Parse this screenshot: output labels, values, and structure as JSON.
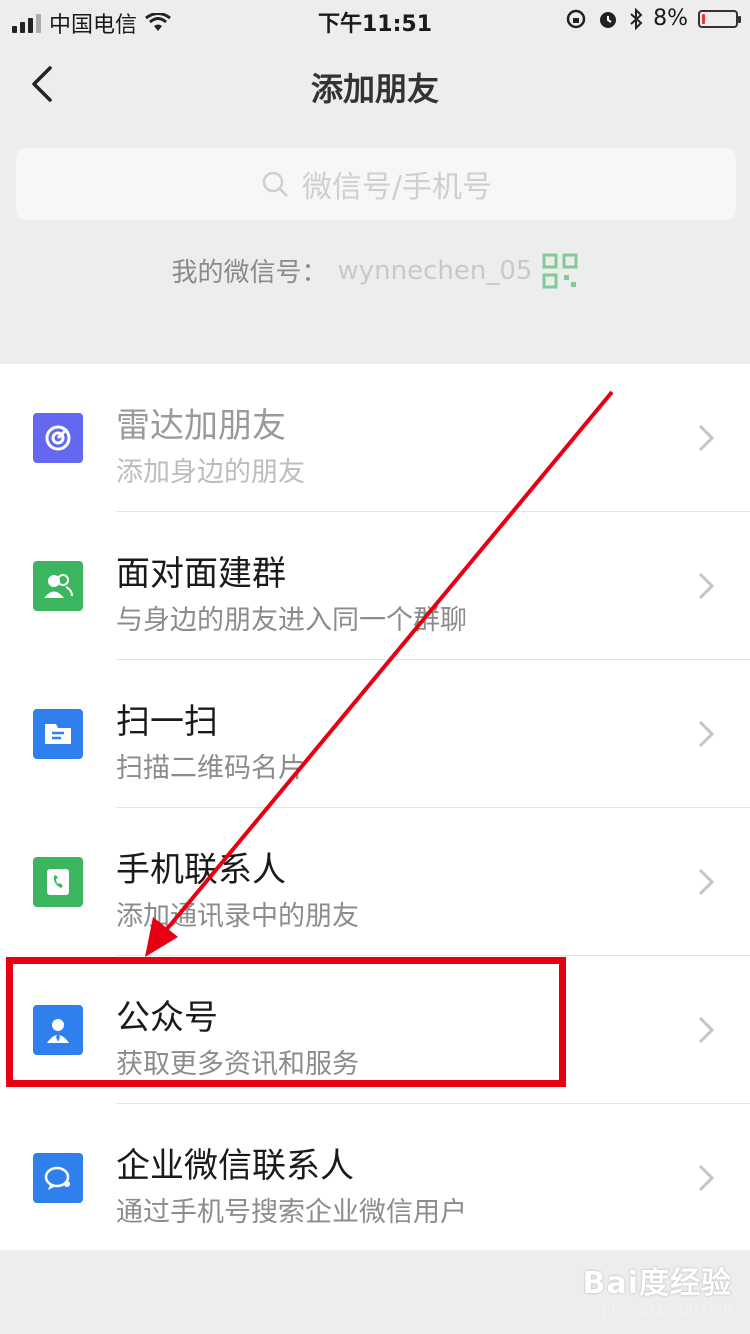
{
  "status_bar": {
    "carrier": "中国电信",
    "time": "下午11:51",
    "battery_percent": "8%",
    "battery_level": 0.08,
    "icons": [
      "signal-icon",
      "wifi-icon",
      "rotation-lock-icon",
      "alarm-icon",
      "bluetooth-icon",
      "battery-icon"
    ]
  },
  "nav": {
    "title": "添加朋友",
    "back_icon": "back-chevron-icon"
  },
  "search": {
    "placeholder": "微信号/手机号"
  },
  "my_id": {
    "label": "我的微信号：",
    "value": "wynnechen_05"
  },
  "items": [
    {
      "title": "雷达加朋友",
      "subtitle": "添加身边的朋友",
      "icon": "radar-icon",
      "color": "#6467f0"
    },
    {
      "title": "面对面建群",
      "subtitle": "与身边的朋友进入同一个群聊",
      "icon": "face-to-face-group-icon",
      "color": "#3bb55e"
    },
    {
      "title": "扫一扫",
      "subtitle": "扫描二维码名片",
      "icon": "scan-icon",
      "color": "#2f80ed"
    },
    {
      "title": "手机联系人",
      "subtitle": "添加通讯录中的朋友",
      "icon": "phone-contacts-icon",
      "color": "#3bb55e"
    },
    {
      "title": "公众号",
      "subtitle": "获取更多资讯和服务",
      "icon": "official-account-icon",
      "color": "#2f80ed"
    },
    {
      "title": "企业微信联系人",
      "subtitle": "通过手机号搜索企业微信用户",
      "icon": "wecom-contacts-icon",
      "color": "#2f80ed"
    }
  ],
  "annotation": {
    "highlight_color": "#e60012"
  },
  "watermark": {
    "line1": "Bai度经验",
    "line2": "jingyan.baidu.com"
  }
}
